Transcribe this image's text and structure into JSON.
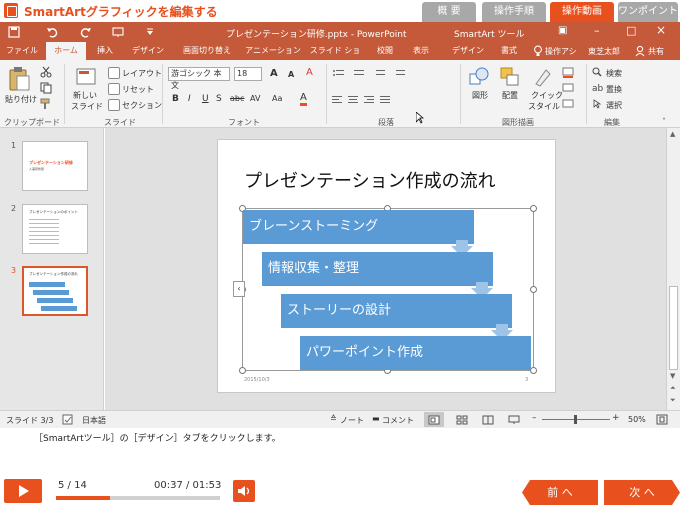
{
  "app": {
    "title": "SmartArtグラフィックを編集する",
    "tabs": [
      {
        "label": "概 要"
      },
      {
        "label": "操作手順"
      },
      {
        "label": "操作動画"
      },
      {
        "label": "ワンポイント"
      }
    ]
  },
  "ppt": {
    "window_title": "プレゼンテーション研修.pptx - PowerPoint",
    "contextual_tool": "SmartArt ツール",
    "qat": {
      "save": "save",
      "undo": "undo",
      "redo": "redo",
      "customize": "customize"
    },
    "window_controls": {
      "restore_ribbon": "▣",
      "minimize": "–",
      "maximize": "□",
      "close": "×"
    },
    "ribbon_tabs": [
      "ファイル",
      "ホーム",
      "挿入",
      "デザイン",
      "画面切り替え",
      "アニメーション",
      "スライド ショー",
      "校閲",
      "表示",
      "デザイン",
      "書式"
    ],
    "tell_me": "操作アシ",
    "user": "東芝太郎",
    "share": "共有",
    "clipboard": {
      "paste": "貼り付け",
      "group": "クリップボード"
    },
    "slides_group": {
      "new_slide_1": "新しい",
      "new_slide_2": "スライド",
      "layout": "レイアウト",
      "reset": "リセット",
      "section": "セクション",
      "group": "スライド"
    },
    "font_group": {
      "font_name": "游ゴシック 本文",
      "font_size": "18",
      "group": "フォント"
    },
    "paragraph": {
      "group": "段落"
    },
    "drawing": {
      "shapes": "図形",
      "arrange": "配置",
      "quick_style_1": "クイック",
      "quick_style_2": "スタイル",
      "group": "図形描画"
    },
    "editing": {
      "find": "検索",
      "replace": "置換",
      "select": "選択",
      "group": "編集"
    }
  },
  "thumbnails": [
    {
      "num": "1",
      "title": "プレゼンテーション研修",
      "sub": "人事研修部"
    },
    {
      "num": "2",
      "title": "プレゼンテーションのポイント"
    },
    {
      "num": "3",
      "title": "プレゼンテーション作成の流れ"
    }
  ],
  "slide": {
    "title": "プレゼンテーション作成の流れ",
    "steps": [
      "ブレーンストーミング",
      "情報収集・整理",
      "ストーリーの設計",
      "パワーポイント作成"
    ],
    "date": "2015/10/3",
    "page": "3"
  },
  "status": {
    "slide_indicator": "スライド 3/3",
    "language": "日本語",
    "notes": "ノート",
    "comments": "コメント",
    "zoom": "50%"
  },
  "instruction": "［SmartArtツール］の［デザイン］タブをクリックします。",
  "player": {
    "page": "5 / 14",
    "time": "00:37 / 01:53",
    "progress": 0.33,
    "prev": "前 へ",
    "next": "次 へ"
  },
  "colors": {
    "brand": "#e8501e",
    "ppt": "#c55a3a",
    "smartart": "#5b9bd5"
  }
}
